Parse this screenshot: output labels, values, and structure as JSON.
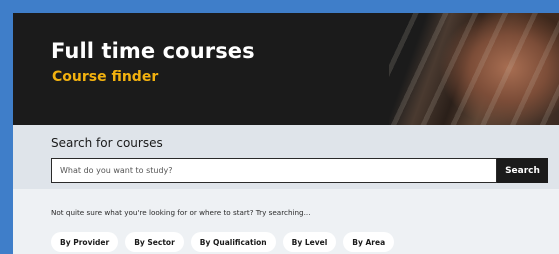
{
  "hero": {
    "title": "Full time courses",
    "subtitle": "Course finder"
  },
  "search": {
    "heading": "Search for courses",
    "placeholder": "What do you want to study?",
    "button_label": "Search"
  },
  "browse": {
    "prompt": "Not quite sure what you're looking for or where to start? Try searching...",
    "chips": [
      "By Provider",
      "By Sector",
      "By Qualification",
      "By Level",
      "By Area"
    ]
  },
  "colors": {
    "page_border": "#3f7ec9",
    "hero_bg": "#1b1b1b",
    "accent": "#f2b10f",
    "search_bg": "#dfe4ea",
    "button_bg": "#1b1b1b"
  }
}
